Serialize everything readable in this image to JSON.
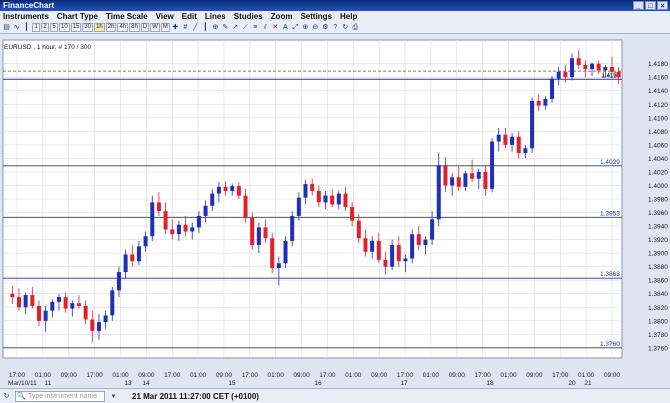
{
  "app": {
    "title": "FinanceChart"
  },
  "menu": [
    "Instruments",
    "Chart Type",
    "Time Scale",
    "View",
    "Edit",
    "Lines",
    "Studies",
    "Zoom",
    "Settings",
    "Help"
  ],
  "toolbar": {
    "timeframes": [
      "1",
      "2",
      "5",
      "10",
      "15",
      "30",
      "1h",
      "2h",
      "4h",
      "8h",
      "D",
      "W",
      "M"
    ],
    "selected": "1h",
    "icon_names": [
      "crosshair-icon",
      "hash-icon",
      "line-icon",
      "bar-icon",
      "zoom-icon",
      "draw-icon",
      "arrow-icon",
      "trend-icon",
      "fib-icon",
      "channel-icon",
      "delete-icon",
      "text-icon",
      "fit-icon",
      "zoom-in-icon",
      "zoom-out-icon",
      "settings-icon",
      "help-icon",
      "refresh-icon",
      "print-icon"
    ]
  },
  "chart": {
    "header": "EURUSD , 1 hour, # 170 / 300",
    "colors": {
      "up": "#1f2fb8",
      "down": "#e0202a",
      "hline": "#2b2fa8",
      "grid": "#d9dbe2",
      "bg": "#ffffff"
    }
  },
  "chart_data": {
    "type": "candlestick",
    "title": "EURUSD , 1 hour, # 170 / 300",
    "ylim": [
      1.3745,
      1.4215
    ],
    "y_ticks": [
      "1.4180",
      "1.4160",
      "1.4140",
      "1.4120",
      "1.4100",
      "1.4080",
      "1.4060",
      "1.4040",
      "1.4020",
      "1.4000",
      "1.3980",
      "1.3960",
      "1.3940",
      "1.3920",
      "1.3900",
      "1.3880",
      "1.3860",
      "1.3840",
      "1.3820",
      "1.3800",
      "1.3780",
      "1.3760"
    ],
    "x_ticks": [
      "17:00",
      "01:00",
      "09:00",
      "17:00",
      "01:00",
      "09:00",
      "17:00",
      "01:00",
      "09:00",
      "17:00",
      "01:00",
      "09:00",
      "17:00",
      "01:00",
      "09:00",
      "17:00",
      "01:00",
      "09:00",
      "17:00",
      "01:00",
      "09:00",
      "17:00",
      "01:00",
      "09:00"
    ],
    "day_labels": [
      "Mar/10/11",
      "11",
      "13",
      "14",
      "15",
      "16",
      "17",
      "18",
      "20",
      "21"
    ],
    "levels": [
      {
        "label": "1.4029",
        "value": 1.4029
      },
      {
        "label": "1.3953",
        "value": 1.3953
      },
      {
        "label": "1.3863",
        "value": 1.3863
      },
      {
        "label": "1.3760",
        "value": 1.376
      }
    ],
    "current_line": {
      "label": "1.4157",
      "value": 1.4157
    },
    "price_label": {
      "label": "1.4159",
      "value": 1.4169
    },
    "candles": [
      [
        1.384,
        1.3852,
        1.3825,
        1.3835
      ],
      [
        1.3835,
        1.3848,
        1.3815,
        1.382
      ],
      [
        1.382,
        1.3842,
        1.381,
        1.3838
      ],
      [
        1.3838,
        1.385,
        1.3818,
        1.3822
      ],
      [
        1.3822,
        1.383,
        1.3792,
        1.38
      ],
      [
        1.38,
        1.3822,
        1.3784,
        1.3815
      ],
      [
        1.3815,
        1.3832,
        1.3805,
        1.3828
      ],
      [
        1.3828,
        1.384,
        1.3815,
        1.3835
      ],
      [
        1.3835,
        1.3842,
        1.3812,
        1.3818
      ],
      [
        1.3818,
        1.383,
        1.3806,
        1.3826
      ],
      [
        1.3826,
        1.3838,
        1.3818,
        1.3822
      ],
      [
        1.3822,
        1.383,
        1.3795,
        1.3802
      ],
      [
        1.3802,
        1.3815,
        1.3768,
        1.3785
      ],
      [
        1.3785,
        1.381,
        1.3772,
        1.3798
      ],
      [
        1.3798,
        1.3815,
        1.3788,
        1.3808
      ],
      [
        1.3808,
        1.385,
        1.38,
        1.3845
      ],
      [
        1.3845,
        1.388,
        1.3835,
        1.3872
      ],
      [
        1.3872,
        1.3905,
        1.3862,
        1.3898
      ],
      [
        1.3898,
        1.3912,
        1.388,
        1.3888
      ],
      [
        1.3888,
        1.3918,
        1.3882,
        1.391
      ],
      [
        1.391,
        1.3932,
        1.3902,
        1.3925
      ],
      [
        1.3925,
        1.3985,
        1.3918,
        1.3975
      ],
      [
        1.3975,
        1.399,
        1.3955,
        1.3962
      ],
      [
        1.3962,
        1.3975,
        1.3928,
        1.3935
      ],
      [
        1.3935,
        1.395,
        1.392,
        1.3928
      ],
      [
        1.3928,
        1.3948,
        1.3918,
        1.3942
      ],
      [
        1.3942,
        1.3955,
        1.3925,
        1.3932
      ],
      [
        1.3932,
        1.3945,
        1.392,
        1.3938
      ],
      [
        1.3938,
        1.3962,
        1.393,
        1.3955
      ],
      [
        1.3955,
        1.3978,
        1.3945,
        1.397
      ],
      [
        1.397,
        1.3995,
        1.3962,
        1.3988
      ],
      [
        1.3988,
        1.4005,
        1.3975,
        1.3998
      ],
      [
        1.3998,
        1.4006,
        1.3985,
        1.3992
      ],
      [
        1.3992,
        1.4003,
        1.3985,
        1.3999
      ],
      [
        1.3999,
        1.4005,
        1.398,
        1.3985
      ],
      [
        1.3985,
        1.3995,
        1.3945,
        1.3952
      ],
      [
        1.3952,
        1.396,
        1.3905,
        1.3912
      ],
      [
        1.3912,
        1.3945,
        1.39,
        1.3938
      ],
      [
        1.3938,
        1.395,
        1.3915,
        1.3922
      ],
      [
        1.3922,
        1.393,
        1.387,
        1.3878
      ],
      [
        1.3878,
        1.3895,
        1.3852,
        1.3885
      ],
      [
        1.3885,
        1.3925,
        1.3878,
        1.3918
      ],
      [
        1.3918,
        1.3962,
        1.391,
        1.3955
      ],
      [
        1.3955,
        1.399,
        1.3948,
        1.3982
      ],
      [
        1.3982,
        1.4008,
        1.3972,
        1.4002
      ],
      [
        1.4002,
        1.401,
        1.3985,
        1.3992
      ],
      [
        1.3992,
        1.4,
        1.3968,
        1.3975
      ],
      [
        1.3975,
        1.3992,
        1.3965,
        1.3985
      ],
      [
        1.3985,
        1.3995,
        1.3968,
        1.3972
      ],
      [
        1.3972,
        1.3992,
        1.3965,
        1.3988
      ],
      [
        1.3988,
        1.3998,
        1.3962,
        1.3968
      ],
      [
        1.3968,
        1.3975,
        1.394,
        1.3948
      ],
      [
        1.3948,
        1.3958,
        1.3915,
        1.3922
      ],
      [
        1.3922,
        1.3935,
        1.3895,
        1.3902
      ],
      [
        1.3902,
        1.3925,
        1.3892,
        1.3918
      ],
      [
        1.3918,
        1.393,
        1.3885,
        1.389
      ],
      [
        1.389,
        1.3902,
        1.3868,
        1.388
      ],
      [
        1.388,
        1.392,
        1.3875,
        1.3912
      ],
      [
        1.3912,
        1.3925,
        1.388,
        1.3888
      ],
      [
        1.3888,
        1.3898,
        1.3872,
        1.3892
      ],
      [
        1.3892,
        1.3935,
        1.3885,
        1.3928
      ],
      [
        1.3928,
        1.394,
        1.3905,
        1.3912
      ],
      [
        1.3912,
        1.3925,
        1.3898,
        1.392
      ],
      [
        1.392,
        1.3962,
        1.3912,
        1.395
      ],
      [
        1.395,
        1.4048,
        1.394,
        1.403
      ],
      [
        1.403,
        1.4042,
        1.399,
        1.4
      ],
      [
        1.4,
        1.4018,
        1.3985,
        1.4012
      ],
      [
        1.4012,
        1.4028,
        1.3992,
        1.3998
      ],
      [
        1.3998,
        1.4022,
        1.3992,
        1.4018
      ],
      [
        1.4018,
        1.4038,
        1.4005,
        1.401
      ],
      [
        1.401,
        1.4025,
        1.3995,
        1.402
      ],
      [
        1.402,
        1.403,
        1.3985,
        1.3995
      ],
      [
        1.3995,
        1.407,
        1.399,
        1.4065
      ],
      [
        1.4065,
        1.4085,
        1.405,
        1.4075
      ],
      [
        1.4075,
        1.4085,
        1.4055,
        1.406
      ],
      [
        1.406,
        1.4078,
        1.405,
        1.4072
      ],
      [
        1.4072,
        1.408,
        1.404,
        1.4048
      ],
      [
        1.4048,
        1.406,
        1.404,
        1.4055
      ],
      [
        1.4055,
        1.413,
        1.4048,
        1.4125
      ],
      [
        1.4125,
        1.4135,
        1.411,
        1.4118
      ],
      [
        1.4118,
        1.4132,
        1.4112,
        1.4128
      ],
      [
        1.4128,
        1.4162,
        1.4122,
        1.4158
      ],
      [
        1.4158,
        1.4175,
        1.4148,
        1.4168
      ],
      [
        1.4168,
        1.4178,
        1.4152,
        1.416
      ],
      [
        1.416,
        1.4195,
        1.4155,
        1.4188
      ],
      [
        1.4188,
        1.42,
        1.4172,
        1.4178
      ],
      [
        1.4178,
        1.4185,
        1.416,
        1.4172
      ],
      [
        1.4172,
        1.4182,
        1.4162,
        1.418
      ],
      [
        1.418,
        1.4185,
        1.4165,
        1.417
      ],
      [
        1.417,
        1.4178,
        1.416,
        1.4175
      ],
      [
        1.4175,
        1.419,
        1.4165,
        1.4168
      ],
      [
        1.4168,
        1.4175,
        1.415,
        1.416
      ]
    ]
  },
  "status": {
    "search_placeholder": "Type instrument name",
    "datetime": "21 Mar 2011 11:27:00  CET (+0100)"
  }
}
